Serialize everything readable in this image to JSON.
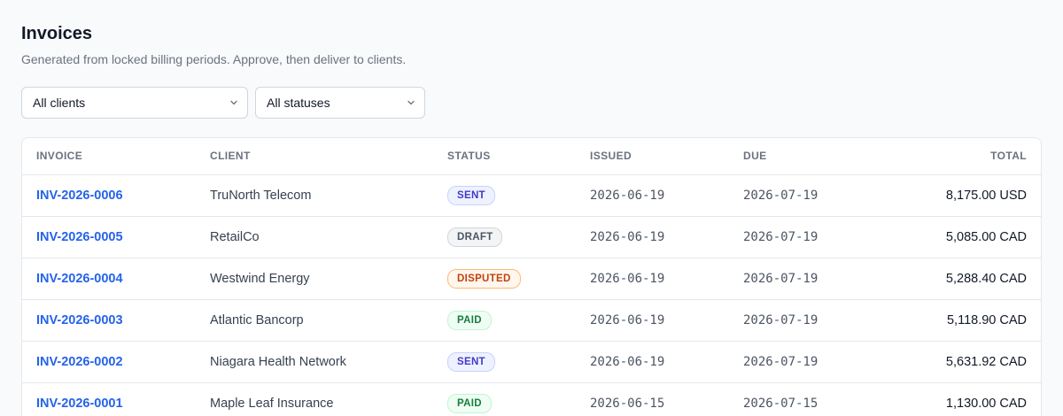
{
  "header": {
    "title": "Invoices",
    "subtitle": "Generated from locked billing periods. Approve, then deliver to clients."
  },
  "filters": {
    "client": "All clients",
    "status": "All statuses"
  },
  "table": {
    "columns": [
      "INVOICE",
      "CLIENT",
      "STATUS",
      "ISSUED",
      "DUE",
      "TOTAL"
    ],
    "rows": [
      {
        "invoice": "INV-2026-0006",
        "client": "TruNorth Telecom",
        "status": "SENT",
        "status_kind": "sent",
        "issued": "2026-06-19",
        "due": "2026-07-19",
        "total": "8,175.00 USD"
      },
      {
        "invoice": "INV-2026-0005",
        "client": "RetailCo",
        "status": "DRAFT",
        "status_kind": "draft",
        "issued": "2026-06-19",
        "due": "2026-07-19",
        "total": "5,085.00 CAD"
      },
      {
        "invoice": "INV-2026-0004",
        "client": "Westwind Energy",
        "status": "DISPUTED",
        "status_kind": "disputed",
        "issued": "2026-06-19",
        "due": "2026-07-19",
        "total": "5,288.40 CAD"
      },
      {
        "invoice": "INV-2026-0003",
        "client": "Atlantic Bancorp",
        "status": "PAID",
        "status_kind": "paid",
        "issued": "2026-06-19",
        "due": "2026-07-19",
        "total": "5,118.90 CAD"
      },
      {
        "invoice": "INV-2026-0002",
        "client": "Niagara Health Network",
        "status": "SENT",
        "status_kind": "sent",
        "issued": "2026-06-19",
        "due": "2026-07-19",
        "total": "5,631.92 CAD"
      },
      {
        "invoice": "INV-2026-0001",
        "client": "Maple Leaf Insurance",
        "status": "PAID",
        "status_kind": "paid",
        "issued": "2026-06-15",
        "due": "2026-07-15",
        "total": "1,130.00 CAD"
      }
    ]
  },
  "icons": {
    "dropdown": "chevron-down-icon"
  }
}
